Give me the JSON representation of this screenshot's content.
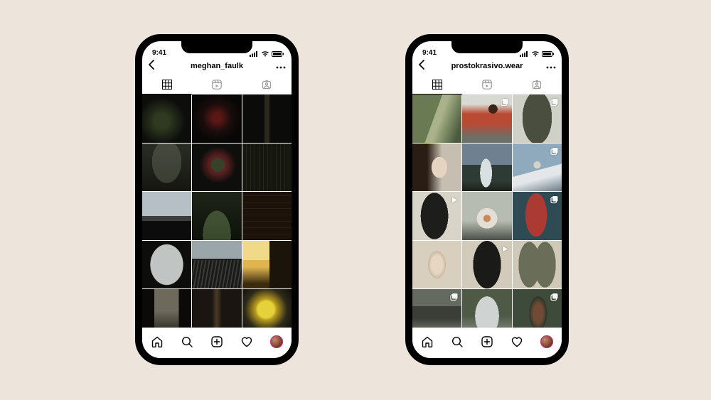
{
  "status_time": "9:41",
  "phones": [
    {
      "username": "meghan_faulk",
      "tabs": [
        "grid",
        "reels",
        "tagged"
      ],
      "active_tab": "grid",
      "avatar_icon": "avatar-profile-photo",
      "cells": [
        {
          "name": "dark-floral-still-life",
          "paint": "p1c1",
          "overlay": null
        },
        {
          "name": "red-vase-baroque",
          "paint": "p1c2",
          "overlay": null
        },
        {
          "name": "figure-in-doorway",
          "paint": "p1c3",
          "overlay": null
        },
        {
          "name": "gothic-arched-window",
          "paint": "p1c4",
          "overlay": null
        },
        {
          "name": "flower-bouquet-dark",
          "paint": "p1c5",
          "overlay": null
        },
        {
          "name": "iron-balcony-garden",
          "paint": "p1c6",
          "overlay": null
        },
        {
          "name": "overcast-view-from-window",
          "paint": "p1c7",
          "overlay": null
        },
        {
          "name": "green-english-garden",
          "paint": "p1c8",
          "overlay": null
        },
        {
          "name": "candlelit-library",
          "paint": "p1c9",
          "overlay": null
        },
        {
          "name": "stone-archway-sky",
          "paint": "p1c10",
          "overlay": null
        },
        {
          "name": "river-under-bridge",
          "paint": "p1c11",
          "overlay": null
        },
        {
          "name": "golden-sunset-silhouette",
          "paint": "p1c12",
          "overlay": null
        },
        {
          "name": "manor-interior-window",
          "paint": "p1c13",
          "overlay": null
        },
        {
          "name": "dim-hallway",
          "paint": "p1c14",
          "overlay": null
        },
        {
          "name": "yellow-flower-arrangement",
          "paint": "p1c15",
          "overlay": null
        }
      ]
    },
    {
      "username": "prostokrasivo.wear",
      "tabs": [
        "grid",
        "reels",
        "tagged"
      ],
      "active_tab": "grid",
      "avatar_icon": "avatar-profile-photo",
      "cells": [
        {
          "name": "model-green-hillside",
          "paint": "p2c1",
          "overlay": null
        },
        {
          "name": "woman-red-top-outdoors",
          "paint": "p2c2",
          "overlay": "carousel"
        },
        {
          "name": "woman-olive-dress-studio",
          "paint": "p2c3",
          "overlay": "carousel"
        },
        {
          "name": "portrait-long-brown-hair",
          "paint": "p2c4",
          "overlay": null
        },
        {
          "name": "woman-white-dress-mountain-lake",
          "paint": "p2c5",
          "overlay": null
        },
        {
          "name": "cloud-ring-over-fjord",
          "paint": "p2c6",
          "overlay": "carousel"
        },
        {
          "name": "back-pose-black-dress",
          "paint": "p2c7",
          "overlay": "video"
        },
        {
          "name": "redhead-white-blouse-field",
          "paint": "p2c8",
          "overlay": null
        },
        {
          "name": "woman-red-dress-teal-wall",
          "paint": "p2c9",
          "overlay": "carousel"
        },
        {
          "name": "dancer-beige-dress-leaning",
          "paint": "p2c10",
          "overlay": null
        },
        {
          "name": "model-black-top-neutral",
          "paint": "p2c11",
          "overlay": "video"
        },
        {
          "name": "two-models-olive-dresses",
          "paint": "p2c12",
          "overlay": null
        },
        {
          "name": "rocky-stream-landscape",
          "paint": "p2c13",
          "overlay": "carousel"
        },
        {
          "name": "woman-by-river-rocks",
          "paint": "p2c14",
          "overlay": null
        },
        {
          "name": "woman-headscarf-forest",
          "paint": "p2c15",
          "overlay": "carousel"
        }
      ]
    }
  ],
  "bottom_nav": [
    "home",
    "search",
    "create",
    "activity",
    "profile"
  ]
}
